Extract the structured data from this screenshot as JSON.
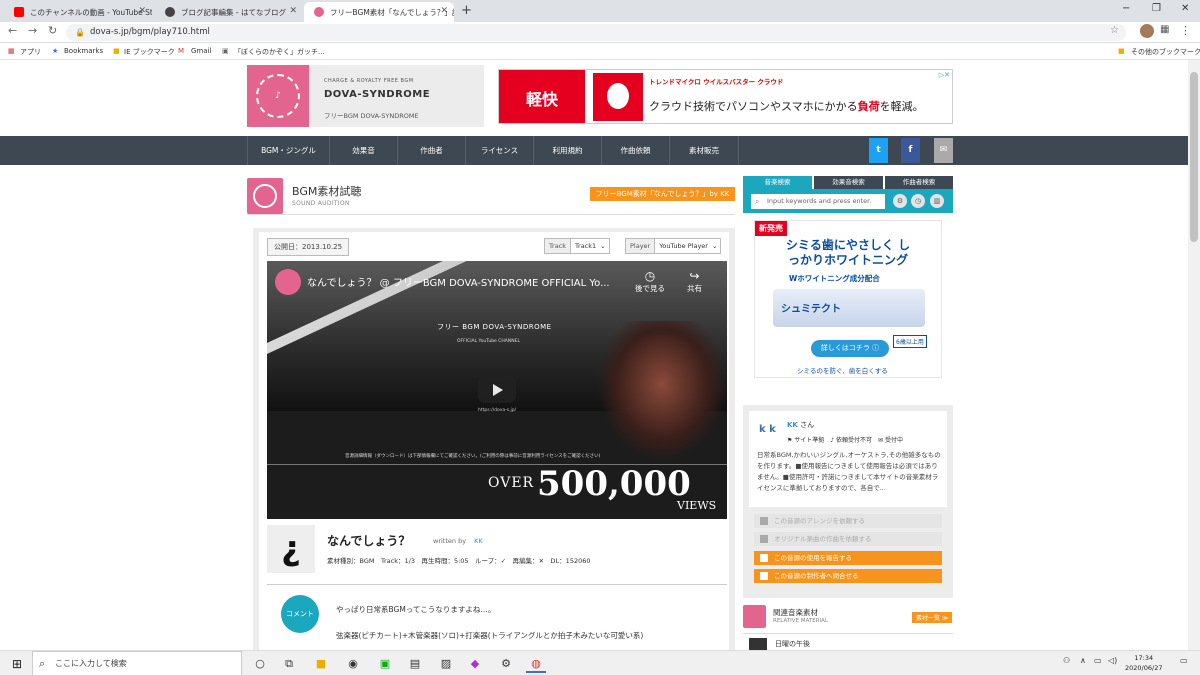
{
  "browser": {
    "tabs": [
      {
        "label": "このチャンネルの動画 - YouTube Stu",
        "icon": "youtube-icon",
        "color": "#ff0000"
      },
      {
        "label": "ブログ記事編集 - はてなブログ",
        "icon": "hatena-icon",
        "color": "#444444"
      },
      {
        "label": "フリーBGM素材「なんでしょう？」試聴",
        "icon": "dova-icon",
        "color": "#e3648f"
      }
    ],
    "new_tab": "+",
    "minimize": "−",
    "maximize": "❐",
    "close": "✕",
    "back": "←",
    "forward": "→",
    "reload": "↻",
    "url": "dova-s.jp/bgm/play710.html",
    "bookmarks": {
      "apps": "アプリ",
      "items": [
        "Bookmarks",
        "IE ブックマーク",
        "Gmail",
        "「ぼくらのかぞく」ガッチ..."
      ],
      "other": "その他のブックマーク"
    }
  },
  "site": {
    "logo_sub": "CHARGE & ROYALTY FREE BGM",
    "logo_title": "DOVA-SYNDROME",
    "logo_jp": "フリーBGM DOVA-SYNDROME",
    "ad_top": {
      "tag": "軽快",
      "brand": "トレンドマイクロ ウイルスバスター クラウド",
      "text_a": "クラウド技術でパソコンやスマホにかかる",
      "text_b": "負荷",
      "text_c": "を軽減。"
    },
    "nav": [
      "BGM・ジングル",
      "効果音",
      "作曲者",
      "ライセンス",
      "利用規約",
      "作曲依頼",
      "素材販売"
    ],
    "social": {
      "twitter": "t",
      "facebook": "f",
      "mail": "✉"
    }
  },
  "section": {
    "title": "BGM素材試聴",
    "subtitle": "SOUND AUDITION",
    "tag": "フリーBGM素材「なんでしょう？」by KK"
  },
  "player": {
    "date": "公開日：2013.10.25",
    "track_label": "Track",
    "track_value": "Track1",
    "player_label": "Player",
    "player_value": "YouTube Player",
    "video": {
      "title": "なんでしょう？ @ フリーBGM DOVA-SYNDROME OFFICIAL Yo...",
      "watch_later": "後で見る",
      "share": "共有",
      "brand": "フリー BGM DOVA-SYNDROME",
      "brand_sub": "OFFICIAL YouTube CHANNEL",
      "url": "https://dova-s.jp/",
      "note": "音源詳細情報（ダウンロード）は下部情報欄にてご確認ください。(ご利用の際は事前に音源利用ライセンスをご確認ください)",
      "over": "OVER",
      "count": "500,000",
      "views": "VIEWS"
    }
  },
  "song": {
    "title": "なんでしょう？",
    "written_by": "written by",
    "author": "KK",
    "meta": "素材種別：BGM　Track：1/3　再生時間：5:05　ループ：✓　再編集：✕　DL：152060"
  },
  "comment": {
    "badge": "コメント",
    "line1": "やっぱり日常系BGMってこうなりますよね…。",
    "line2": "弦楽器(ピチカート)+木管楽器(ソロ)+打楽器(トライアングルとか拍子木みたいな可愛い系)"
  },
  "sidebar": {
    "tabs": [
      "音楽検索",
      "効果音検索",
      "作曲者検索"
    ],
    "search_placeholder": "Input keywords and press enter.",
    "ad": {
      "new": "新発売",
      "headline": "シミる歯にやさしく しっかりホワイトニング",
      "sub": "Wホワイトニング成分配合",
      "product": "シュミテクト",
      "button": "詳しくはコチラ ⓘ",
      "age": "6歳以上用",
      "foot": "シミるのを防ぐ、歯を白くする"
    },
    "author": {
      "logo": "k k",
      "name": "KK",
      "suffix": "さん",
      "flags": "⚑ サイト準拠　♪ 依頼受付不可　✉ 受付中",
      "desc": "日常系BGM,かわいいジングル,オーケストラ,その他雑多なものを作ります。■使用報告につきまして使用報告は必須ではありません。■使用許可・許諾につきまして本サイトの音楽素材ライセンスに準拠しておりますので、各自で..."
    },
    "buttons": [
      "この音源のアレンジを依頼する",
      "オリジナル楽曲の作曲を依頼する",
      "この音源の使用を報告する",
      "この音源の制作者へ問合せる"
    ],
    "related": {
      "title": "関連音楽素材",
      "subtitle": "RELATIVE MATERIAL",
      "tag": "素材一覧 ≫",
      "item": "日曜の午後"
    }
  },
  "taskbar": {
    "search": "ここに入力して検索",
    "time": "17:34",
    "date": "2020/06/27"
  }
}
